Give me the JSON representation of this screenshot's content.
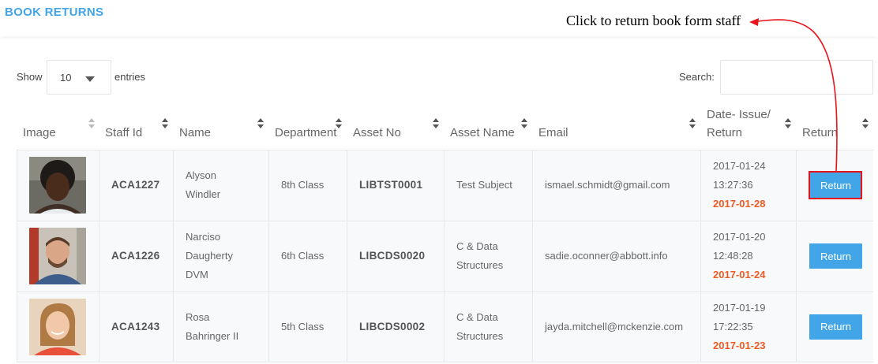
{
  "page": {
    "title": "BOOK RETURNS"
  },
  "annotation": {
    "text": "Click to return book form staff",
    "color": "#e8141b"
  },
  "controls": {
    "show_label": "Show",
    "entries_value": "10",
    "entries_label": "entries",
    "search_label": "Search:",
    "search_value": ""
  },
  "table": {
    "columns": [
      "Image",
      "Staff Id",
      "Name",
      "Department",
      "Asset No",
      "Asset Name",
      "Email",
      "Date- Issue/\nReturn",
      "Return"
    ],
    "rows": [
      {
        "avatar": "avatar-woman-curly-hair",
        "staff_id": "ACA1227",
        "name_line1": "Alyson",
        "name_line2": "Windler",
        "name_line3": "",
        "department": "8th Class",
        "asset_no": "LIBTST0001",
        "asset_name_line1": "Test Subject",
        "asset_name_line2": "",
        "email": "ismael.schmidt@gmail.com",
        "issue_date": "2017-01-24",
        "issue_time": "13:27:36",
        "return_date": "2017-01-28",
        "button": "Return"
      },
      {
        "avatar": "avatar-man-beard",
        "staff_id": "ACA1226",
        "name_line1": "Narciso",
        "name_line2": "Daugherty",
        "name_line3": "DVM",
        "department": "6th Class",
        "asset_no": "LIBCDS0020",
        "asset_name_line1": "C & Data",
        "asset_name_line2": "Structures",
        "email": "sadie.oconner@abbott.info",
        "issue_date": "2017-01-20",
        "issue_time": "12:48:28",
        "return_date": "2017-01-24",
        "button": "Return"
      },
      {
        "avatar": "avatar-woman-smiling",
        "staff_id": "ACA1243",
        "name_line1": "Rosa",
        "name_line2": "Bahringer II",
        "name_line3": "",
        "department": "5th Class",
        "asset_no": "LIBCDS0002",
        "asset_name_line1": "C & Data",
        "asset_name_line2": "Structures",
        "email": "jayda.mitchell@mckenzie.com",
        "issue_date": "2017-01-19",
        "issue_time": "17:22:35",
        "return_date": "2017-01-23",
        "button": "Return"
      }
    ]
  },
  "colors": {
    "accent": "#42a5e8",
    "return_date": "#f05a23",
    "highlight": "#e8141b"
  }
}
